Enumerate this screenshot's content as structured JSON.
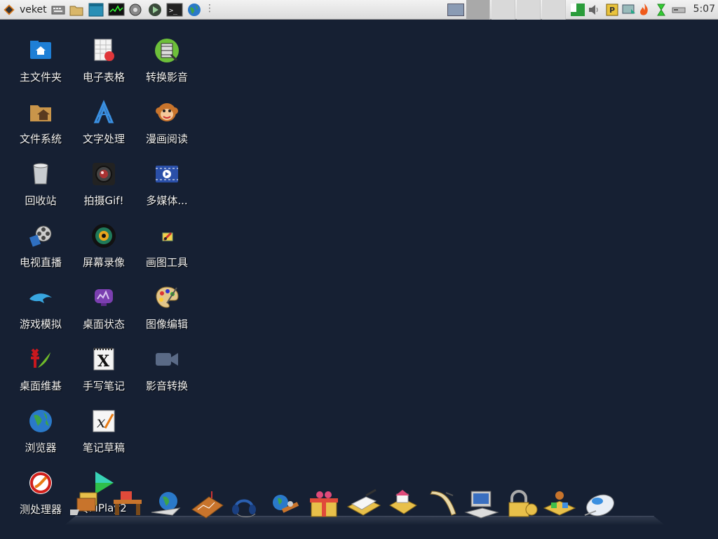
{
  "taskbar": {
    "menu_label": "veket",
    "quick_launch": [
      "keyboard-icon",
      "folder-icon",
      "window-icon",
      "system-monitor-icon",
      "settings-icon",
      "media-play-icon",
      "terminal-icon",
      "globe-icon"
    ],
    "overflow_glyph": "⋮",
    "clock": "5:07",
    "accent": "#e87b14"
  },
  "desktop": {
    "columns": [
      [
        "主文件夹",
        "文件系统",
        "回收站",
        "电视直播",
        "游戏模拟",
        "桌面维基",
        "浏览器",
        "测处理器"
      ],
      [
        "电子表格",
        "文字处理",
        "拍摄Gif!",
        "屏幕录像",
        "桌面状态",
        "手写笔记",
        "笔记草稿",
        "QMPlay2"
      ],
      [
        "转换影音",
        "漫画阅读",
        "多媒体...",
        "画图工具",
        "图像编辑",
        "影音转换"
      ]
    ]
  },
  "dock": {
    "items": [
      "card-stack-icon",
      "desk-icon",
      "globe-plane-icon",
      "chart-board-icon",
      "headset-icon",
      "satellite-icon",
      "gift-box-icon",
      "document-pen-icon",
      "house-icon",
      "scroll-icon",
      "computer-icon",
      "padlock-icon",
      "network-blocks-icon",
      "mouse-icon"
    ]
  },
  "colors": {
    "desktop_bg": "#162033",
    "label_text": "#f2f2f2"
  }
}
